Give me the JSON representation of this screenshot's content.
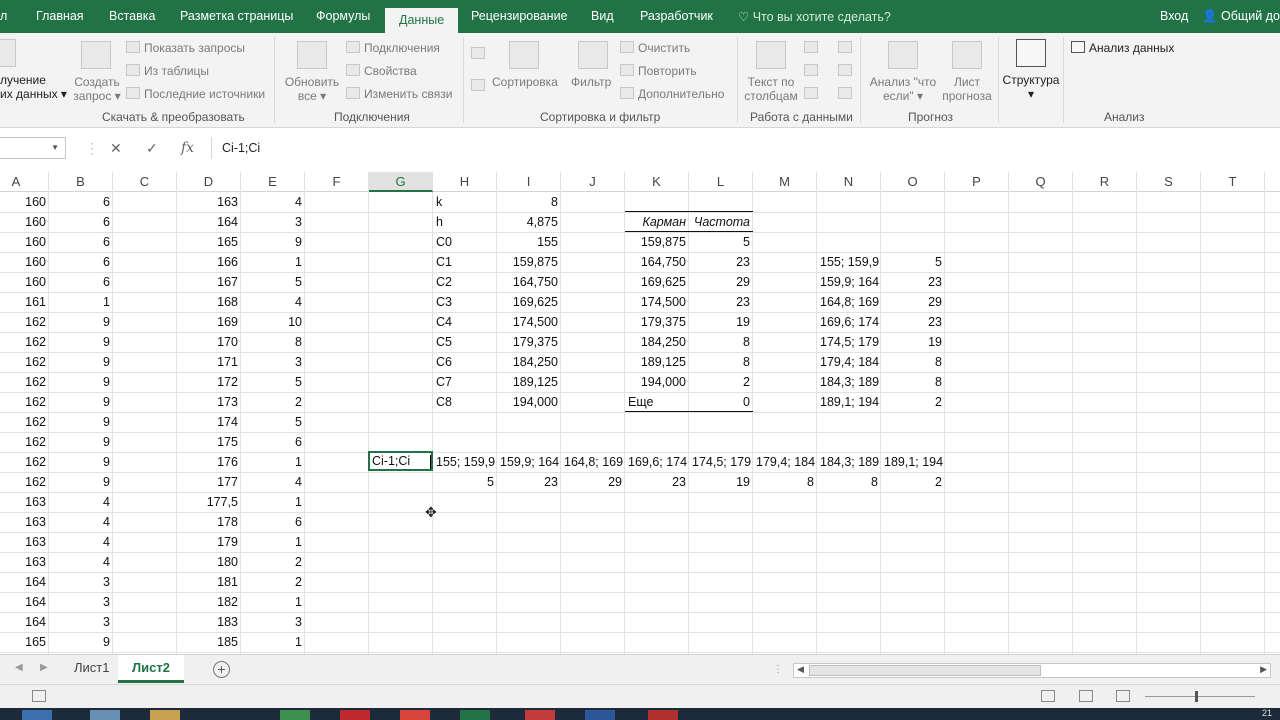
{
  "tabs": {
    "file_fragment": "л",
    "items": [
      "Главная",
      "Вставка",
      "Разметка страницы",
      "Формулы",
      "Данные",
      "Рецензирование",
      "Вид",
      "Разработчик"
    ],
    "active": "Данные",
    "tell_me": "Что вы хотите сделать?",
    "login": "Вход",
    "share": "Общий до"
  },
  "ribbon": {
    "get_data": {
      "line1": "лучение",
      "line2": "их данных"
    },
    "create_query": {
      "line1": "Создать",
      "line2": "запрос"
    },
    "show_queries": "Показать запросы",
    "from_table": "Из таблицы",
    "recent_sources": "Последние источники",
    "group_get_transform": "Скачать & преобразовать",
    "refresh_all": {
      "line1": "Обновить",
      "line2": "все"
    },
    "connections": "Подключения",
    "properties": "Свойства",
    "edit_links": "Изменить связи",
    "group_connections": "Подключения",
    "sort_az_icon": "sort-az-icon",
    "sort": "Сортировка",
    "filter": "Фильтр",
    "clear": "Очистить",
    "reapply": "Повторить",
    "advanced": "Дополнительно",
    "group_sort_filter": "Сортировка и фильтр",
    "text_to_columns": {
      "line1": "Текст по",
      "line2": "столбцам"
    },
    "group_data_tools": "Работа с данными",
    "what_if": {
      "line1": "Анализ \"что",
      "line2": "если\""
    },
    "forecast_sheet": {
      "line1": "Лист",
      "line2": "прогноза"
    },
    "group_forecast": "Прогноз",
    "outline": "Структура",
    "data_analysis": "Анализ данных",
    "group_analysis": "Анализ"
  },
  "formula_bar": {
    "name_box": "",
    "cancel": "✕",
    "enter": "✓",
    "fx": "fx",
    "value": "Ci-1;Ci"
  },
  "columns": [
    "A",
    "B",
    "C",
    "D",
    "E",
    "F",
    "G",
    "H",
    "I",
    "J",
    "K",
    "L",
    "M",
    "N",
    "O",
    "P",
    "Q",
    "R",
    "S",
    "T"
  ],
  "selected_column": "G",
  "sheet": {
    "col_a": [
      "160",
      "160",
      "160",
      "160",
      "160",
      "161",
      "162",
      "162",
      "162",
      "162",
      "162",
      "162",
      "162",
      "162",
      "162",
      "163",
      "163",
      "163",
      "163",
      "164",
      "164",
      "164",
      "165"
    ],
    "col_b": [
      "6",
      "6",
      "6",
      "6",
      "6",
      "1",
      "9",
      "9",
      "9",
      "9",
      "9",
      "9",
      "9",
      "9",
      "9",
      "4",
      "4",
      "4",
      "4",
      "3",
      "3",
      "3",
      "9"
    ],
    "col_d": [
      "163",
      "164",
      "165",
      "166",
      "167",
      "168",
      "169",
      "170",
      "171",
      "172",
      "173",
      "174",
      "175",
      "176",
      "177",
      "177,5",
      "178",
      "179",
      "180",
      "181",
      "182",
      "183",
      "185"
    ],
    "col_e": [
      "4",
      "3",
      "9",
      "1",
      "5",
      "4",
      "10",
      "8",
      "3",
      "5",
      "2",
      "5",
      "6",
      "1",
      "4",
      "1",
      "6",
      "1",
      "2",
      "2",
      "1",
      "3",
      "1"
    ],
    "params": [
      {
        "name": "k",
        "value": "8"
      },
      {
        "name": "h",
        "value": "4,875"
      },
      {
        "name": "C0",
        "value": "155"
      },
      {
        "name": "C1",
        "value": "159,875"
      },
      {
        "name": "C2",
        "value": "164,750"
      },
      {
        "name": "C3",
        "value": "169,625"
      },
      {
        "name": "C4",
        "value": "174,500"
      },
      {
        "name": "C5",
        "value": "179,375"
      },
      {
        "name": "C6",
        "value": "184,250"
      },
      {
        "name": "C7",
        "value": "189,125"
      },
      {
        "name": "C8",
        "value": "194,000"
      }
    ],
    "freq_table": {
      "header_bin": "Карман",
      "header_freq": "Частота",
      "rows": [
        {
          "bin": "159,875",
          "freq": "5"
        },
        {
          "bin": "164,750",
          "freq": "23"
        },
        {
          "bin": "169,625",
          "freq": "29"
        },
        {
          "bin": "174,500",
          "freq": "23"
        },
        {
          "bin": "179,375",
          "freq": "19"
        },
        {
          "bin": "184,250",
          "freq": "8"
        },
        {
          "bin": "189,125",
          "freq": "8"
        },
        {
          "bin": "194,000",
          "freq": "2"
        },
        {
          "bin": "Еще",
          "freq": "0"
        }
      ]
    },
    "intervals": [
      {
        "label": "155; 159,9",
        "freq": "5"
      },
      {
        "label": "159,9; 164",
        "freq": "23"
      },
      {
        "label": "164,8; 169",
        "freq": "29"
      },
      {
        "label": "169,6; 174",
        "freq": "23"
      },
      {
        "label": "174,5; 179",
        "freq": "19"
      },
      {
        "label": "179,4; 184",
        "freq": "8"
      },
      {
        "label": "184,3; 189",
        "freq": "8"
      },
      {
        "label": "189,1; 194",
        "freq": "2"
      }
    ],
    "editing_cell": "Ci-1;Ci"
  },
  "sheet_tabs": [
    "Лист1",
    "Лист2"
  ],
  "active_sheet": "Лист2",
  "taskbar_clock": "21"
}
